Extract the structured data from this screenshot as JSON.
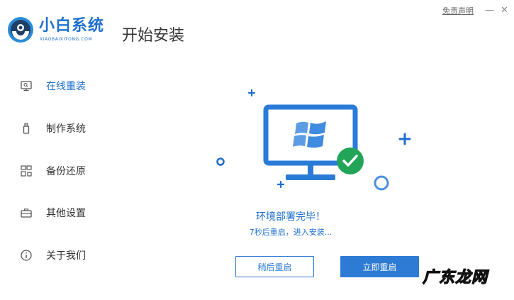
{
  "header": {
    "brand_name": "小白系统",
    "brand_sub": "XIAOBAIXITONG.COM",
    "page_title": "开始安装",
    "disclaimer": "免责声明",
    "minimize_glyph": "—",
    "close_glyph": "✕"
  },
  "sidebar": {
    "items": [
      {
        "label": "在线重装",
        "icon": "monitor-icon",
        "active": true
      },
      {
        "label": "制作系统",
        "icon": "usb-icon",
        "active": false
      },
      {
        "label": "备份还原",
        "icon": "backup-grid-icon",
        "active": false
      },
      {
        "label": "其他设置",
        "icon": "toolbox-icon",
        "active": false
      },
      {
        "label": "关于我们",
        "icon": "info-icon",
        "active": false
      }
    ]
  },
  "main": {
    "status": "环境部署完毕！",
    "countdown": "7秒后重启，进入安装...",
    "later_button": "稍后重启",
    "restart_button": "立即重启"
  },
  "watermark": "广东龙网",
  "colors": {
    "accent": "#1f6fd0",
    "button_blue": "#2d7bd4",
    "success_green": "#22a559",
    "text": "#333333"
  }
}
